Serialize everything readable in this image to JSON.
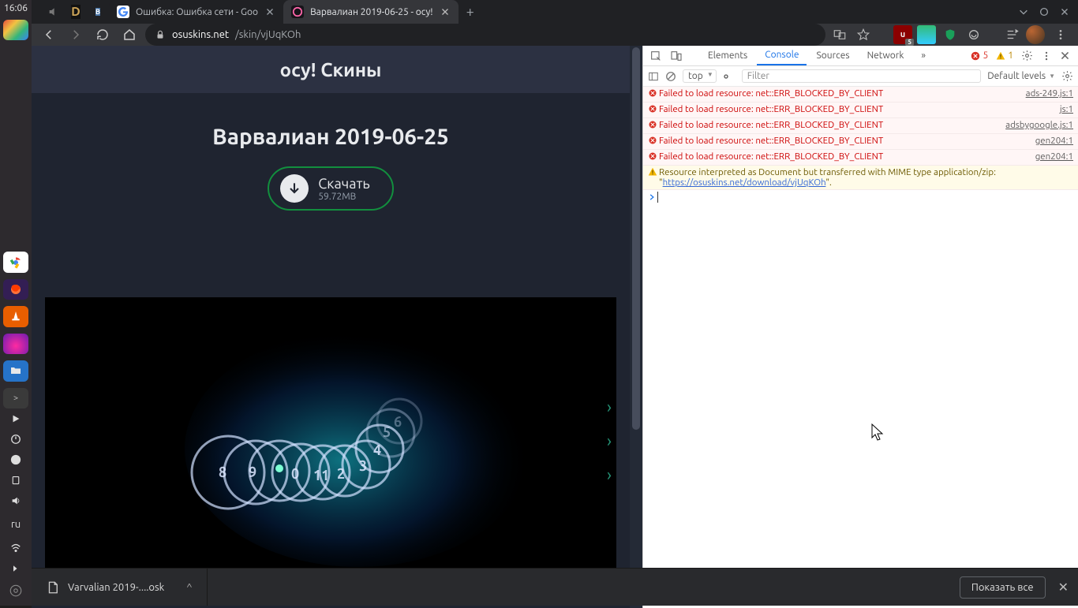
{
  "os": {
    "clock": "16:06",
    "lang": "ru"
  },
  "launcher_apps": {
    "chrome": {
      "name": "chrome"
    },
    "firefox": {
      "name": "firefox"
    },
    "vlc": {
      "name": "vlc"
    },
    "flame": {
      "name": "flame"
    },
    "files": {
      "name": "files"
    },
    "terminal": {
      "name": "terminal"
    }
  },
  "browser": {
    "mini_tabs": [
      "d-site",
      "vk"
    ],
    "tabs": [
      {
        "title": "Ошибка: Ошибка сети - Goo",
        "active": false
      },
      {
        "title": "Варвалиан 2019-06-25 - осу!",
        "active": true
      }
    ],
    "url_host": "osuskins.net",
    "url_path": "/skin/vjUqKOh",
    "extensions_count": "5"
  },
  "page": {
    "site_title": "осу! Скины",
    "skin_title": "Варвалиан 2019-06-25",
    "download_label": "Скачать",
    "download_size": "59.72MB"
  },
  "devtools": {
    "tabs": {
      "elements": "Elements",
      "console": "Console",
      "sources": "Sources",
      "network": "Network"
    },
    "error_count": "5",
    "warn_count": "1",
    "context": "top",
    "filter_placeholder": "Filter",
    "levels": "Default levels",
    "errors": [
      {
        "msg": "Failed to load resource: net::ERR_BLOCKED_BY_CLIENT",
        "src": "ads-249.js:1"
      },
      {
        "msg": "Failed to load resource: net::ERR_BLOCKED_BY_CLIENT",
        "src": "js:1"
      },
      {
        "msg": "Failed to load resource: net::ERR_BLOCKED_BY_CLIENT",
        "src": "adsbygoogle.js:1"
      },
      {
        "msg": "Failed to load resource: net::ERR_BLOCKED_BY_CLIENT",
        "src": "gen204:1"
      },
      {
        "msg": "Failed to load resource: net::ERR_BLOCKED_BY_CLIENT",
        "src": "gen204:1"
      }
    ],
    "warning_pre": "Resource interpreted as Document but transferred with MIME type application/zip: \"",
    "warning_link": "https://osuskins.net/download/vjUqKOh",
    "warning_post": "\"."
  },
  "download_shelf": {
    "filename": "Varvalian 2019-....osk",
    "show_all": "Показать все"
  }
}
